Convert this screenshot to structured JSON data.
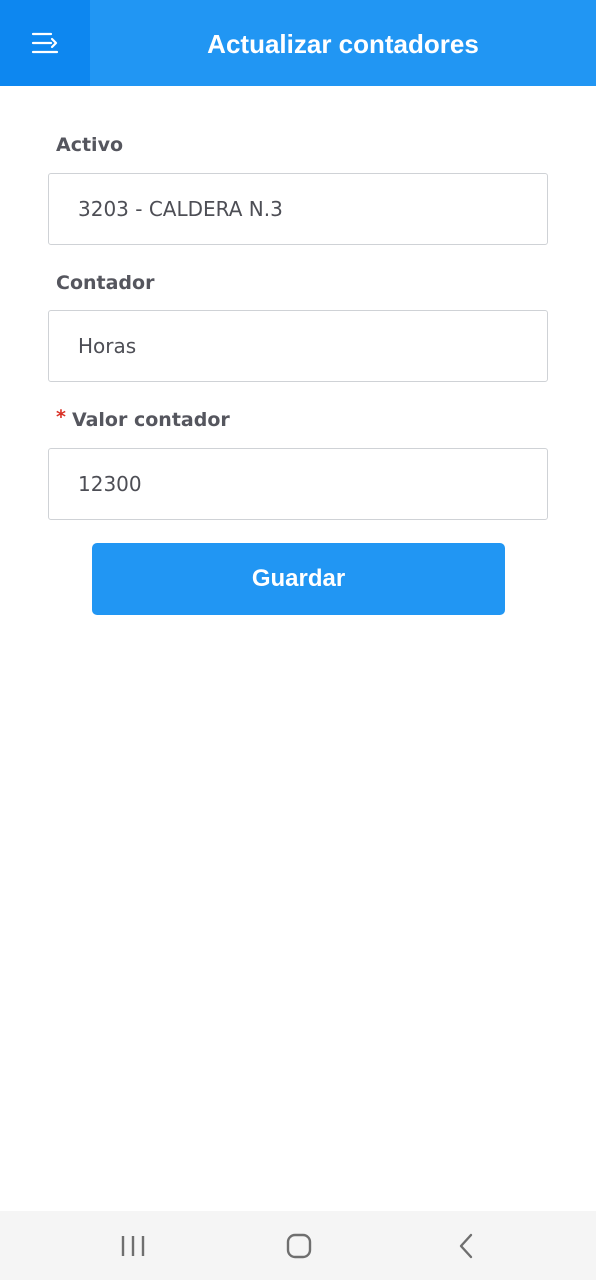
{
  "header": {
    "title": "Actualizar contadores",
    "menu_icon": "menu-arrow-icon",
    "background_color": "#2196f3",
    "menu_background_color": "#0d87f0"
  },
  "form": {
    "asset": {
      "label": "Activo",
      "value": "3203 - CALDERA N.3"
    },
    "counter": {
      "label": "Contador",
      "value": "Horas"
    },
    "counter_value": {
      "required_mark": "*",
      "label": "Valor contador",
      "value": "12300"
    },
    "save_label": "Guardar"
  },
  "navbar": {
    "recents_icon": "recents-icon",
    "home_icon": "home-icon",
    "back_icon": "back-icon"
  }
}
